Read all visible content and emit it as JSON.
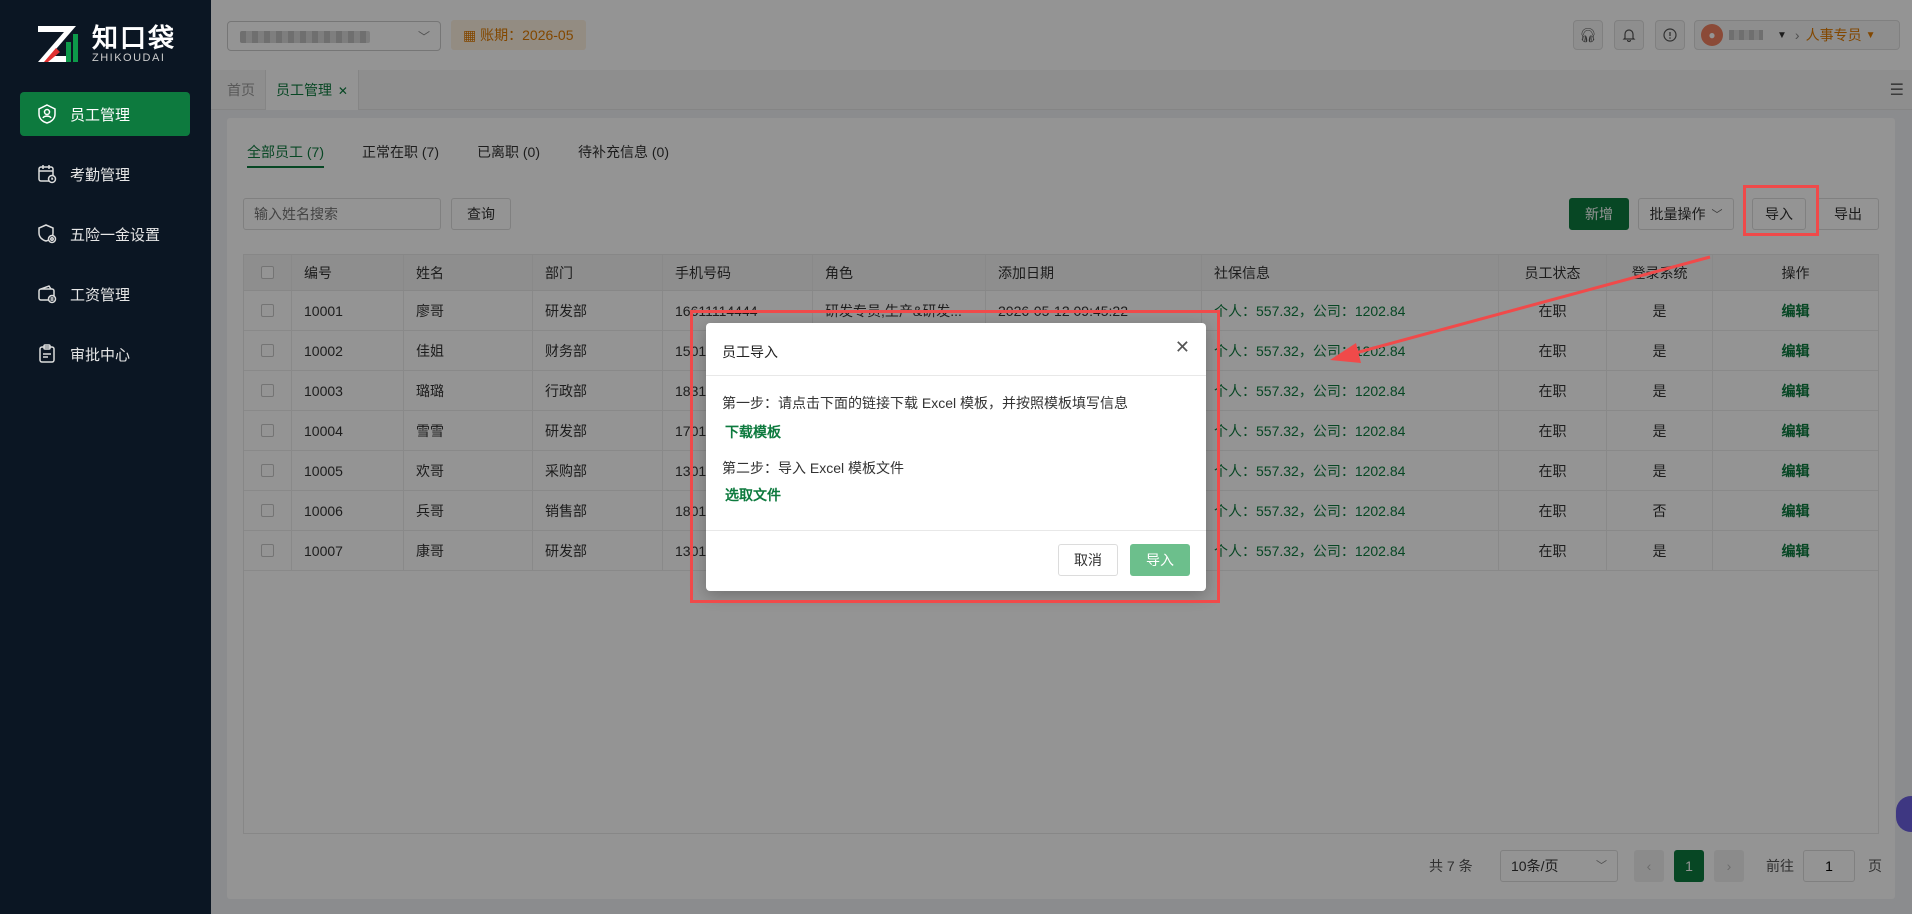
{
  "brand": {
    "name_cn": "知口袋",
    "name_en": "ZHIKOUDAI"
  },
  "sidebar": {
    "items": [
      {
        "label": "员工管理",
        "icon": "user-badge-icon",
        "active": true
      },
      {
        "label": "考勤管理",
        "icon": "calendar-clock-icon",
        "active": false
      },
      {
        "label": "五险一金设置",
        "icon": "shield-gear-icon",
        "active": false
      },
      {
        "label": "工资管理",
        "icon": "wallet-icon",
        "active": false
      },
      {
        "label": "审批中心",
        "icon": "clipboard-icon",
        "active": false
      }
    ]
  },
  "header": {
    "period": "账期：2026-05",
    "role": "人事专员"
  },
  "tabs": {
    "home": "首页",
    "current": "员工管理"
  },
  "subtabs": [
    {
      "label": "全部员工 (7)",
      "active": true
    },
    {
      "label": "正常在职 (7)",
      "active": false
    },
    {
      "label": "已离职 (0)",
      "active": false
    },
    {
      "label": "待补充信息 (0)",
      "active": false
    }
  ],
  "toolbar": {
    "search_placeholder": "输入姓名搜索",
    "query": "查询",
    "add": "新增",
    "batch": "批量操作",
    "import": "导入",
    "export": "导出"
  },
  "table": {
    "columns": [
      "编号",
      "姓名",
      "部门",
      "手机号码",
      "角色",
      "添加日期",
      "社保信息",
      "员工状态",
      "登录系统",
      "操作"
    ],
    "rows": [
      {
        "id": "10001",
        "name": "廖哥",
        "dept": "研发部",
        "phone": "16611114444",
        "role": "研发专员,生产&研发...",
        "date": "2026-05-12 09:45:22",
        "social": "个人：557.32，公司：1202.84",
        "status": "在职",
        "login": "是",
        "action": "编辑"
      },
      {
        "id": "10002",
        "name": "佳姐",
        "dept": "财务部",
        "phone": "1501",
        "role": "",
        "date": "",
        "social": "个人：557.32，公司：1202.84",
        "status": "在职",
        "login": "是",
        "action": "编辑"
      },
      {
        "id": "10003",
        "name": "璐璐",
        "dept": "行政部",
        "phone": "1831",
        "role": "",
        "date": "",
        "social": "个人：557.32，公司：1202.84",
        "status": "在职",
        "login": "是",
        "action": "编辑"
      },
      {
        "id": "10004",
        "name": "雪雪",
        "dept": "研发部",
        "phone": "1701",
        "role": "",
        "date": "",
        "social": "个人：557.32，公司：1202.84",
        "status": "在职",
        "login": "是",
        "action": "编辑"
      },
      {
        "id": "10005",
        "name": "欢哥",
        "dept": "采购部",
        "phone": "1301",
        "role": "",
        "date": "",
        "social": "个人：557.32，公司：1202.84",
        "status": "在职",
        "login": "是",
        "action": "编辑"
      },
      {
        "id": "10006",
        "name": "兵哥",
        "dept": "销售部",
        "phone": "1801",
        "role": "",
        "date": "",
        "social": "个人：557.32，公司：1202.84",
        "status": "在职",
        "login": "否",
        "action": "编辑"
      },
      {
        "id": "10007",
        "name": "康哥",
        "dept": "研发部",
        "phone": "1301",
        "role": "",
        "date": "",
        "social": "个人：557.32，公司：1202.84",
        "status": "在职",
        "login": "是",
        "action": "编辑"
      }
    ]
  },
  "pagination": {
    "total": "共 7 条",
    "page_size": "10条/页",
    "current_page": "1",
    "goto_label": "前往",
    "goto_value": "1",
    "page_suffix": "页"
  },
  "modal": {
    "title": "员工导入",
    "step1": "第一步：请点击下面的链接下载 Excel 模板，并按照模板填写信息",
    "download": "下载模板",
    "step2": "第二步：导入 Excel 模板文件",
    "choose": "选取文件",
    "cancel": "取消",
    "confirm": "导入"
  },
  "colors": {
    "brand_green": "#0d7a3e",
    "accent_orange": "#e07b00",
    "annotation_red": "#f04a4a",
    "sidebar_bg": "#0b1623"
  }
}
